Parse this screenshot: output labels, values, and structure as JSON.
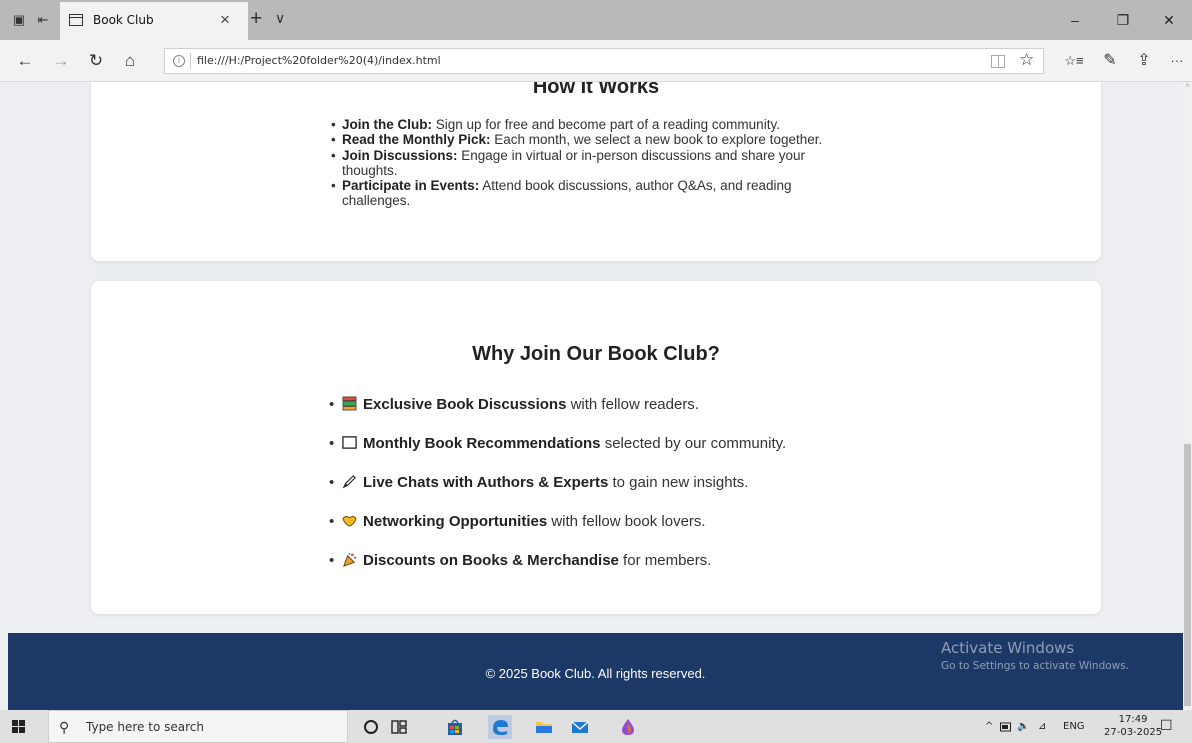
{
  "browser": {
    "tab_title": "Book Club",
    "tab_close": "×",
    "new_tab": "+",
    "tab_menu": "∨",
    "url": "file:///H:/Project%20folder%20(4)/index.html",
    "info_icon_glyph": "i",
    "window": {
      "minimize": "–",
      "restore": "❐",
      "close": "✕"
    },
    "nav": {
      "back": "←",
      "forward": "→",
      "refresh": "↻",
      "home": "⌂"
    },
    "toolbar": {
      "favorite": "☆",
      "favorites_hub": "☆≡",
      "notes": "✎",
      "share": "⇪",
      "more": "···"
    },
    "icons": [
      "tab-actions-icon",
      "set-aside-tabs-icon",
      "page-icon",
      "reading-view-icon",
      "star-icon"
    ]
  },
  "page": {
    "how_it_works": {
      "title": "How It Works",
      "items": [
        {
          "bold": "Join the Club:",
          "text": " Sign up for free and become part of a reading community."
        },
        {
          "bold": "Read the Monthly Pick:",
          "text": " Each month, we select a new book to explore together."
        },
        {
          "bold": "Join Discussions:",
          "text": " Engage in virtual or in-person discussions and share your thoughts."
        },
        {
          "bold": "Participate in Events:",
          "text": " Attend book discussions, author Q&As, and reading challenges."
        }
      ]
    },
    "why_join": {
      "title": "Why Join Our Book Club?",
      "items": [
        {
          "icon": "books-icon",
          "bold": "Exclusive Book Discussions",
          "text": " with fellow readers."
        },
        {
          "icon": "book-icon",
          "bold": "Monthly Book Recommendations",
          "text": " selected by our community."
        },
        {
          "icon": "pen-icon",
          "bold": "Live Chats with Authors & Experts",
          "text": " to gain new insights."
        },
        {
          "icon": "handshake-icon",
          "bold": "Networking Opportunities",
          "text": " with fellow book lovers."
        },
        {
          "icon": "party-popper-icon",
          "bold": "Discounts on Books & Merchandise",
          "text": " for members."
        }
      ]
    },
    "footer": {
      "text": "© 2025 Book Club. All rights reserved."
    },
    "watermark": {
      "line1": "Activate Windows",
      "line2": "Go to Settings to activate Windows."
    }
  },
  "taskbar": {
    "search_placeholder": "Type here to search",
    "search_glyph": "⚲",
    "apps": [
      "cortana-icon",
      "task-view-icon",
      "store-icon",
      "edge-icon",
      "file-explorer-icon",
      "mail-icon",
      "paint-icon"
    ],
    "tray": {
      "chevron": "^",
      "volume": "🔈",
      "network": "⊿",
      "language": "ENG"
    },
    "time": "17:49",
    "date": "27-03-2025",
    "notification_glyph": "☐"
  },
  "colors": {
    "footer_bg": "#1c3866",
    "page_bg": "#eceef2",
    "card_bg": "#ffffff",
    "titlebar": "#b9b9b9"
  }
}
